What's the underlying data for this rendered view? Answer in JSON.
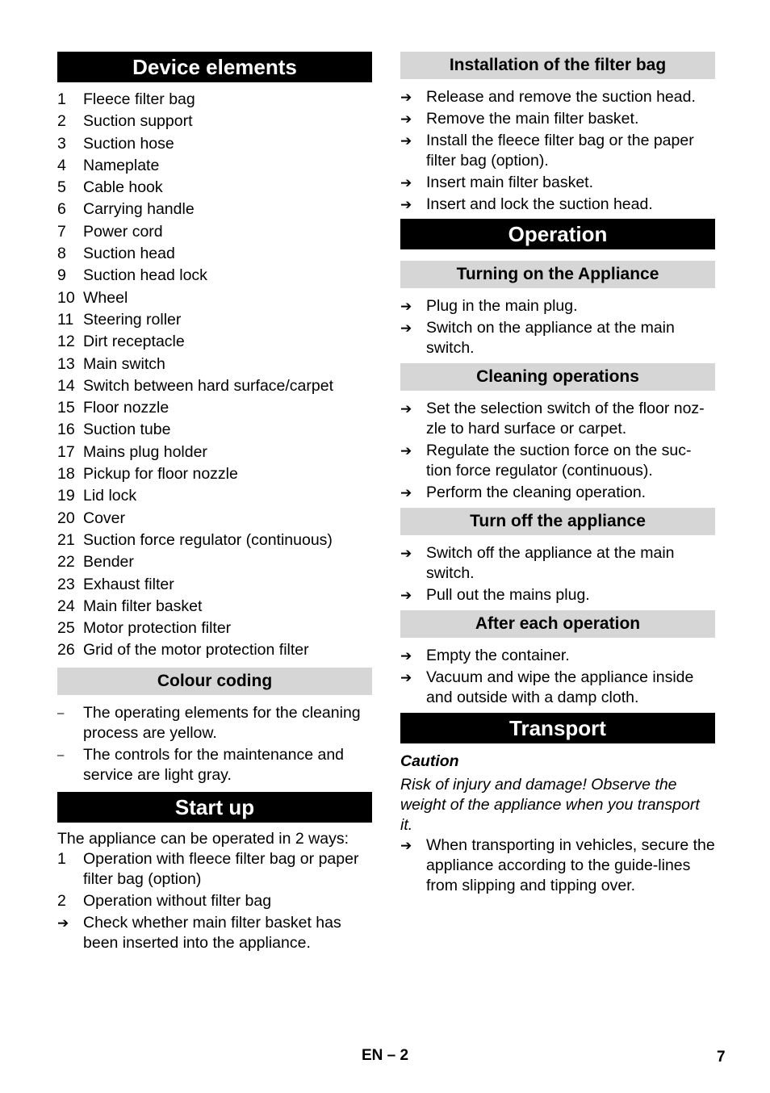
{
  "left": {
    "device_elements": {
      "title": "Device elements",
      "items": [
        {
          "n": "1",
          "label": "Fleece filter bag"
        },
        {
          "n": "2",
          "label": "Suction support"
        },
        {
          "n": "3",
          "label": "Suction hose"
        },
        {
          "n": "4",
          "label": "Nameplate"
        },
        {
          "n": "5",
          "label": "Cable hook"
        },
        {
          "n": "6",
          "label": "Carrying handle"
        },
        {
          "n": "7",
          "label": "Power cord"
        },
        {
          "n": "8",
          "label": "Suction head"
        },
        {
          "n": "9",
          "label": "Suction head lock"
        },
        {
          "n": "10",
          "label": "Wheel"
        },
        {
          "n": "11",
          "label": "Steering roller"
        },
        {
          "n": "12",
          "label": "Dirt receptacle"
        },
        {
          "n": "13",
          "label": "Main switch"
        },
        {
          "n": "14",
          "label": "Switch between hard surface/carpet"
        },
        {
          "n": "15",
          "label": "Floor nozzle"
        },
        {
          "n": "16",
          "label": "Suction tube"
        },
        {
          "n": "17",
          "label": "Mains plug holder"
        },
        {
          "n": "18",
          "label": "Pickup for floor nozzle"
        },
        {
          "n": "19",
          "label": "Lid lock"
        },
        {
          "n": "20",
          "label": "Cover"
        },
        {
          "n": "21",
          "label": "Suction force regulator (continuous)"
        },
        {
          "n": "22",
          "label": "Bender"
        },
        {
          "n": "23",
          "label": "Exhaust filter"
        },
        {
          "n": "24",
          "label": "Main filter basket"
        },
        {
          "n": "25",
          "label": "Motor protection filter"
        },
        {
          "n": "26",
          "label": "Grid of the motor protection filter"
        }
      ]
    },
    "colour_coding": {
      "title": "Colour coding",
      "marker": "–",
      "items": [
        "The operating elements for the cleaning process are yellow.",
        "The controls for the maintenance and service are light gray."
      ]
    },
    "start_up": {
      "title": "Start up",
      "intro": "The appliance can be operated in 2 ways:",
      "options": [
        {
          "n": "1",
          "label": "Operation with fleece filter bag or paper filter bag (option)"
        },
        {
          "n": "2",
          "label": "Operation without filter bag"
        }
      ],
      "steps": [
        "Check whether main filter basket has been inserted into the appliance."
      ]
    }
  },
  "right": {
    "installation": {
      "title": "Installation of the filter bag",
      "steps": [
        "Release and remove the suction head.",
        "Remove the main filter basket.",
        "Install the fleece filter bag or the paper filter bag (option).",
        "Insert main filter basket.",
        "Insert and lock the suction head."
      ]
    },
    "operation": {
      "title": "Operation",
      "turning_on": {
        "title": "Turning on the Appliance",
        "steps": [
          "Plug in the main plug.",
          "Switch on the appliance at the main switch."
        ]
      },
      "cleaning": {
        "title": "Cleaning operations",
        "steps": [
          "Set the selection switch of the floor noz-zle to hard surface or carpet.",
          "Regulate the suction force on the suc-tion force regulator (continuous).",
          "Perform the cleaning operation."
        ]
      },
      "turn_off": {
        "title": "Turn off the appliance",
        "steps": [
          "Switch off the appliance at the main switch.",
          "Pull out the mains plug."
        ]
      },
      "after_each": {
        "title": "After each operation",
        "steps": [
          "Empty the container.",
          "Vacuum and wipe the appliance inside and outside with a damp cloth."
        ]
      }
    },
    "transport": {
      "title": "Transport",
      "caution_title": "Caution",
      "caution_text": "Risk of injury and damage! Observe the weight of the appliance when you transport it.",
      "steps": [
        "When transporting in vehicles, secure the appliance according to the guide-lines from slipping and tipping over."
      ]
    }
  },
  "arrow_glyph": "➔",
  "footer": {
    "language_page": "EN – 2",
    "page_number": "7"
  }
}
